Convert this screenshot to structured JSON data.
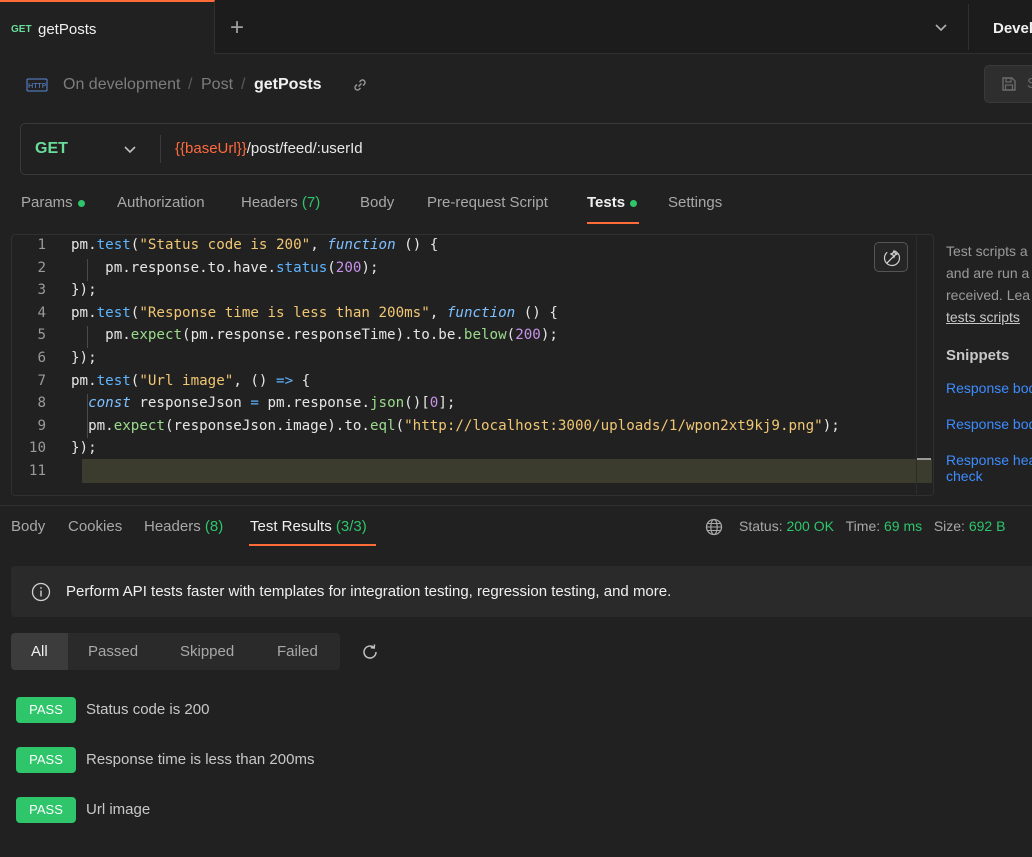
{
  "tab": {
    "method": "GET",
    "name": "getPosts",
    "new_tab": "+"
  },
  "environment": {
    "label": "Devel"
  },
  "breadcrumb": {
    "icon": "HTTP",
    "items": [
      "On development",
      "Post",
      "getPosts"
    ],
    "separator": "/"
  },
  "save_button": {
    "label": "S"
  },
  "request": {
    "method": "GET",
    "url_variable": "{{baseUrl}}",
    "url_path": "/post/feed/:userId"
  },
  "request_tabs": {
    "params": "Params",
    "authorization": "Authorization",
    "headers": "Headers",
    "headers_count": "(7)",
    "body": "Body",
    "prerequest": "Pre-request Script",
    "tests": "Tests",
    "settings": "Settings"
  },
  "editor": {
    "line_numbers": [
      "1",
      "2",
      "3",
      "4",
      "5",
      "6",
      "7",
      "8",
      "9",
      "10",
      "11"
    ]
  },
  "right_panel": {
    "desc_lines": [
      "Test scripts a",
      "and are run a",
      "received. Lea"
    ],
    "desc_link": "tests scripts",
    "snippets_title": "Snippets",
    "snippets": [
      "Response bod",
      "Response bod",
      "Response hea",
      "check"
    ]
  },
  "response_tabs": {
    "body": "Body",
    "cookies": "Cookies",
    "headers": "Headers",
    "headers_count": "(8)",
    "test_results": "Test Results",
    "test_results_count": "(3/3)"
  },
  "status": {
    "status_label": "Status:",
    "status_value": "200 OK",
    "time_label": "Time:",
    "time_value": "69 ms",
    "size_label": "Size:",
    "size_value": "692 B"
  },
  "banner": {
    "text": "Perform API tests faster with templates for integration testing, regression testing, and more."
  },
  "filters": [
    "All",
    "Passed",
    "Skipped",
    "Failed"
  ],
  "results": [
    {
      "badge": "PASS",
      "name": "Status code is 200"
    },
    {
      "badge": "PASS",
      "name": "Response time is less than 200ms"
    },
    {
      "badge": "PASS",
      "name": "Url image"
    }
  ],
  "colors": {
    "accent": "#ff6c37",
    "success": "#2ec56b",
    "link": "#3e8cff",
    "url_variable": "#ff6a3d"
  }
}
